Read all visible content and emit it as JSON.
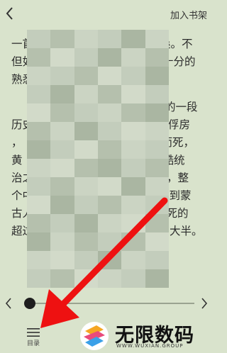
{
  "header": {
    "title": "",
    "add_to_shelf": "加入书架"
  },
  "content": {
    "para1": [
      "一首",
      "桑。不",
      "但如",
      "十分的",
      "熟悉"
    ],
    "para2": [
      "的一段",
      "历史",
      "俘房",
      "，",
      "而死，",
      "黄",
      "酷统",
      "治之",
      "，整",
      "个中",
      "入到蒙",
      "古人",
      "亡死的",
      "超过",
      "大半。"
    ]
  },
  "footer": {
    "menu_label": "目录"
  },
  "watermark": {
    "brand_cn": "无限数码",
    "brand_en": "WWW.WUXIAN.GROUP"
  },
  "colors": {
    "background": "#d9e3cc",
    "arrow": "#ee1111"
  }
}
